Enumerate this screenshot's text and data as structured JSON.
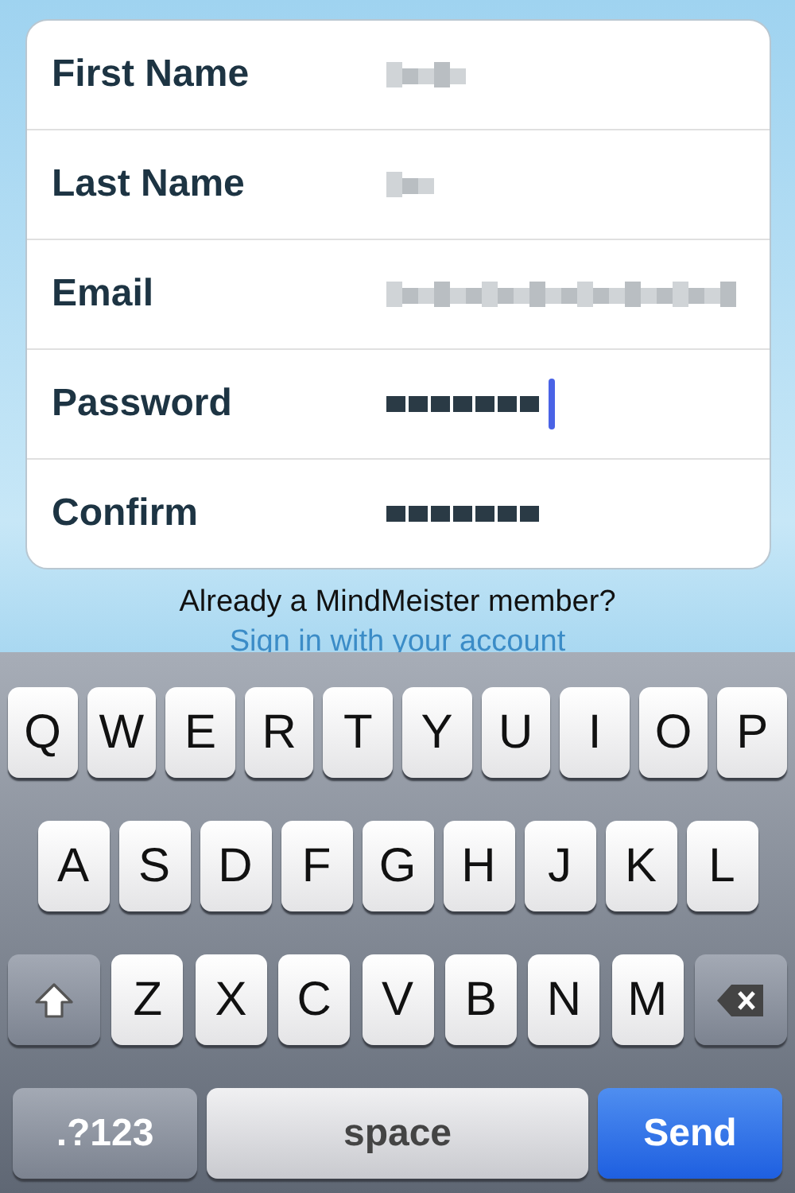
{
  "form": {
    "fields": [
      {
        "label": "First Name",
        "kind": "text",
        "focused": false
      },
      {
        "label": "Last Name",
        "kind": "text",
        "focused": false
      },
      {
        "label": "Email",
        "kind": "text",
        "focused": false
      },
      {
        "label": "Password",
        "kind": "password",
        "focused": true
      },
      {
        "label": "Confirm",
        "kind": "password",
        "focused": false
      }
    ]
  },
  "prompt": "Already a MindMeister member?",
  "sign_in_link": "Sign in with your account",
  "keyboard": {
    "rows": [
      [
        {
          "kind": "letter",
          "label": "Q"
        },
        {
          "kind": "letter",
          "label": "W"
        },
        {
          "kind": "letter",
          "label": "E"
        },
        {
          "kind": "letter",
          "label": "R"
        },
        {
          "kind": "letter",
          "label": "T"
        },
        {
          "kind": "letter",
          "label": "Y"
        },
        {
          "kind": "letter",
          "label": "U"
        },
        {
          "kind": "letter",
          "label": "I"
        },
        {
          "kind": "letter",
          "label": "O"
        },
        {
          "kind": "letter",
          "label": "P"
        }
      ],
      [
        {
          "kind": "letter",
          "label": "A"
        },
        {
          "kind": "letter",
          "label": "S"
        },
        {
          "kind": "letter",
          "label": "D"
        },
        {
          "kind": "letter",
          "label": "F"
        },
        {
          "kind": "letter",
          "label": "G"
        },
        {
          "kind": "letter",
          "label": "H"
        },
        {
          "kind": "letter",
          "label": "J"
        },
        {
          "kind": "letter",
          "label": "K"
        },
        {
          "kind": "letter",
          "label": "L"
        }
      ],
      [
        {
          "kind": "shift"
        },
        {
          "kind": "letter",
          "label": "Z"
        },
        {
          "kind": "letter",
          "label": "X"
        },
        {
          "kind": "letter",
          "label": "C"
        },
        {
          "kind": "letter",
          "label": "V"
        },
        {
          "kind": "letter",
          "label": "B"
        },
        {
          "kind": "letter",
          "label": "N"
        },
        {
          "kind": "letter",
          "label": "M"
        },
        {
          "kind": "delete"
        }
      ]
    ],
    "mode_key": ".?123",
    "space_key": "space",
    "return_key": "Send"
  }
}
